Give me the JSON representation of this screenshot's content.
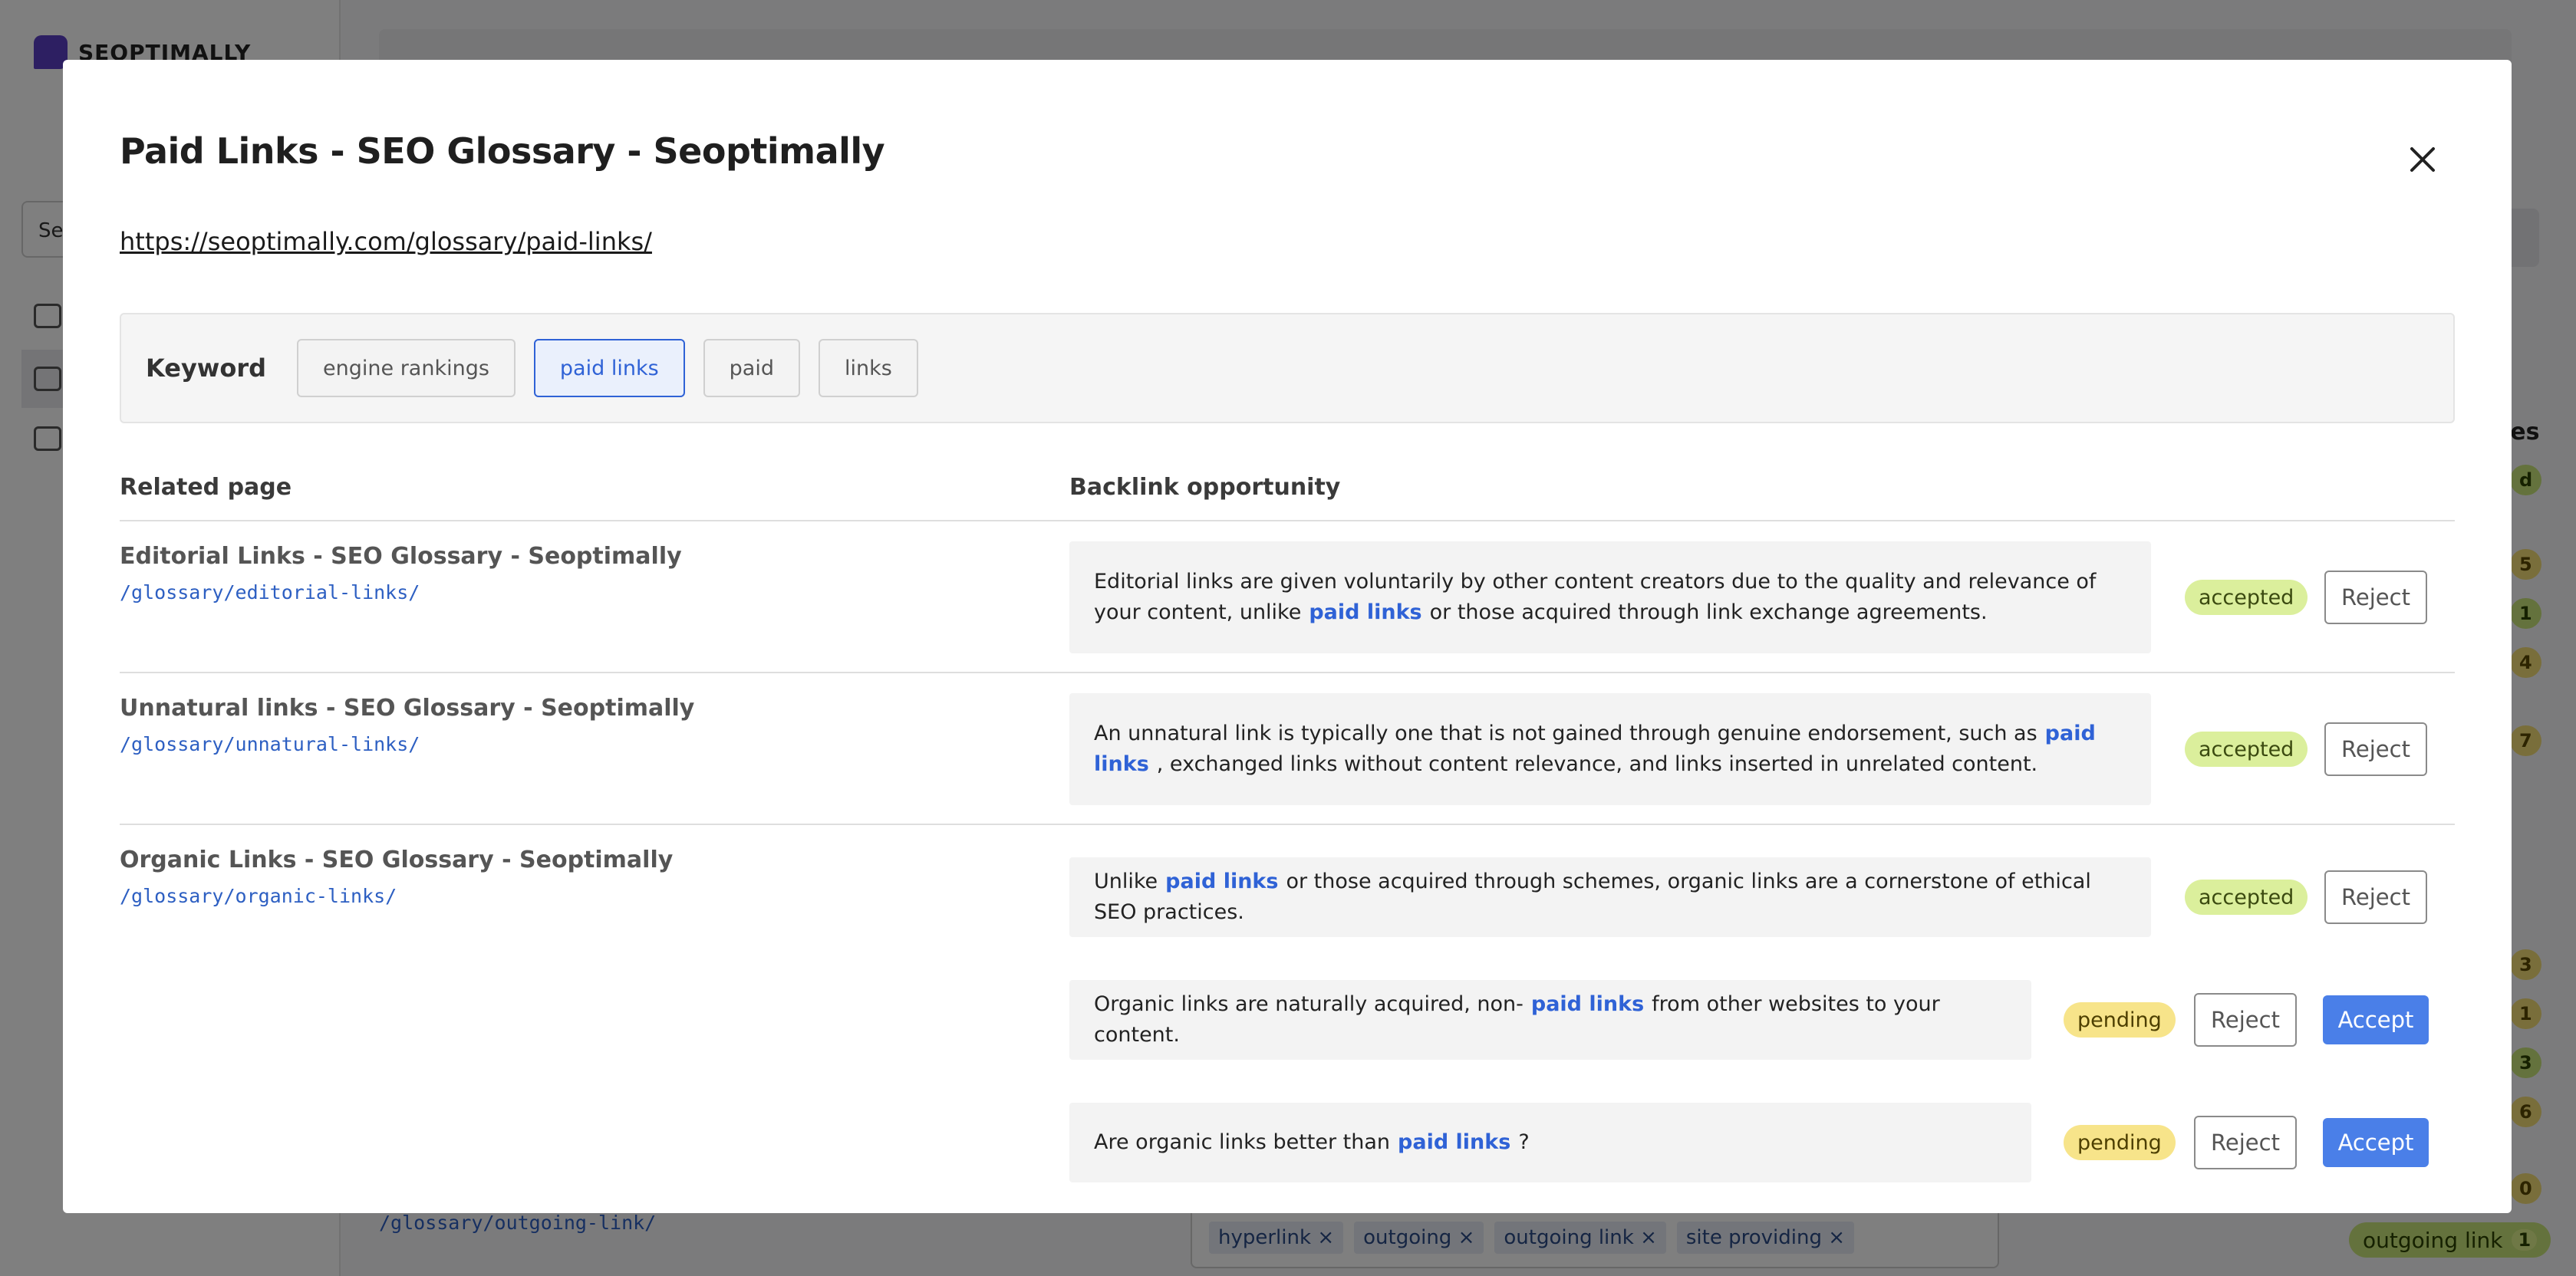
{
  "background": {
    "brand": "SEOPTIMALLY",
    "select_value": "Se",
    "side_title_fragment": "ies",
    "side_pill_first": "d",
    "side_counts": [
      "5",
      "1",
      "4",
      "7",
      "3",
      "1",
      "3",
      "6",
      "0"
    ],
    "row_path": "/glossary/outgoing-link/",
    "tags": [
      "hyperlink",
      "outgoing",
      "outgoing link",
      "site providing"
    ],
    "tag_remove_glyph": "×",
    "outgoing_label": "outgoing link",
    "outgoing_count": "1"
  },
  "modal": {
    "title": "Paid Links - SEO Glossary - Seoptimally",
    "url": "https://seoptimally.com/glossary/paid-links/",
    "keyword_label": "Keyword",
    "keywords": [
      {
        "label": "engine rankings",
        "active": false
      },
      {
        "label": "paid links",
        "active": true
      },
      {
        "label": "paid",
        "active": false
      },
      {
        "label": "links",
        "active": false
      }
    ],
    "columns": {
      "related": "Related page",
      "opportunity": "Backlink opportunity"
    },
    "rows": [
      {
        "title": "Editorial Links - SEO Glossary - Seoptimally",
        "path": "/glossary/editorial-links/",
        "opportunities": [
          {
            "before": "Editorial links are given voluntarily by other content creators due to the quality and relevance of your content, unlike",
            "highlight": "paid links",
            "after": "or those acquired through link exchange agreements.",
            "status": "accepted",
            "reject": "Reject"
          }
        ]
      },
      {
        "title": "Unnatural links - SEO Glossary - Seoptimally",
        "path": "/glossary/unnatural-links/",
        "opportunities": [
          {
            "before": "An unnatural link is typically one that is not gained through genuine endorsement, such as",
            "highlight": "paid links",
            "after": ", exchanged links without content relevance, and links inserted in unrelated content.",
            "status": "accepted",
            "reject": "Reject"
          }
        ]
      },
      {
        "title": "Organic Links - SEO Glossary - Seoptimally",
        "path": "/glossary/organic-links/",
        "opportunities": [
          {
            "before": "Unlike",
            "highlight": "paid links",
            "after": "or those acquired through schemes, organic links are a cornerstone of ethical SEO practices.",
            "status": "accepted",
            "reject": "Reject"
          },
          {
            "before": "Organic links are naturally acquired, non-",
            "highlight": "paid links",
            "after": "from other websites to your content.",
            "status": "pending",
            "reject": "Reject",
            "accept": "Accept"
          },
          {
            "before": "Are organic links better than",
            "highlight": "paid links",
            "after": "?",
            "status": "pending",
            "reject": "Reject",
            "accept": "Accept"
          }
        ]
      }
    ]
  },
  "colors": {
    "accent": "#2f62d6",
    "accept_button": "#4a7fe8",
    "accepted_badge": "#dbef9c",
    "pending_badge": "#f7e48a"
  }
}
